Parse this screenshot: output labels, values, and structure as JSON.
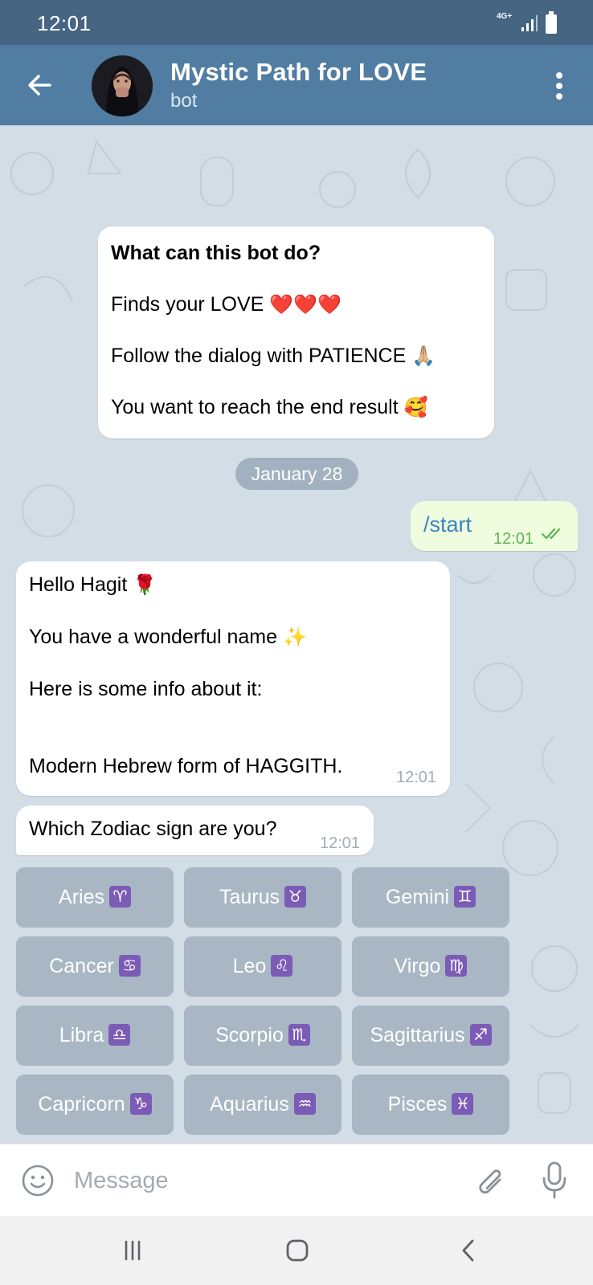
{
  "status_bar": {
    "time": "12:01",
    "network": "4G+"
  },
  "header": {
    "title": "Mystic Path for LOVE",
    "subtitle": "bot"
  },
  "intro": {
    "title": "What can this bot do?",
    "lines": [
      "Finds your LOVE",
      "Follow the dialog with PATIENCE",
      "You want to reach the end result"
    ],
    "emojis": [
      "❤️❤️❤️",
      "🙏🏼",
      "🥰"
    ]
  },
  "date_divider": "January 28",
  "messages": {
    "outgoing": {
      "text": "/start",
      "time": "12:01"
    },
    "bot_1": {
      "line1": "Hello Hagit",
      "emoji1": "🌹",
      "line2": "You have a wonderful name",
      "emoji2": "✨",
      "line3": "Here is some info about it:",
      "line4": "Modern Hebrew form of HAGGITH.",
      "time": "12:01"
    },
    "bot_2": {
      "text": "Which Zodiac sign are you?",
      "time": "12:01"
    }
  },
  "keyboard": [
    {
      "label": "Aries",
      "symbol": "♈"
    },
    {
      "label": "Taurus",
      "symbol": "♉"
    },
    {
      "label": "Gemini",
      "symbol": "♊"
    },
    {
      "label": "Cancer",
      "symbol": "♋"
    },
    {
      "label": "Leo",
      "symbol": "♌"
    },
    {
      "label": "Virgo",
      "symbol": "♍"
    },
    {
      "label": "Libra",
      "symbol": "♎"
    },
    {
      "label": "Scorpio",
      "symbol": "♏"
    },
    {
      "label": "Sagittarius",
      "symbol": "♐"
    },
    {
      "label": "Capricorn",
      "symbol": "♑"
    },
    {
      "label": "Aquarius",
      "symbol": "♒"
    },
    {
      "label": "Pisces",
      "symbol": "♓"
    }
  ],
  "input": {
    "placeholder": "Message"
  },
  "icons": {
    "back": "arrow-left-icon",
    "menu": "more-vertical-icon",
    "emoji": "smile-icon",
    "attach": "paperclip-icon",
    "mic": "microphone-icon",
    "nav": [
      "recents-icon",
      "home-icon",
      "back-icon"
    ]
  },
  "colors": {
    "header": "#517da2",
    "status_bar": "#456582",
    "chat_bg": "#d2dde5",
    "outgoing_bubble": "#effdde",
    "command_link": "#3a85c4",
    "zodiac_badge": "#7b5bb5"
  }
}
